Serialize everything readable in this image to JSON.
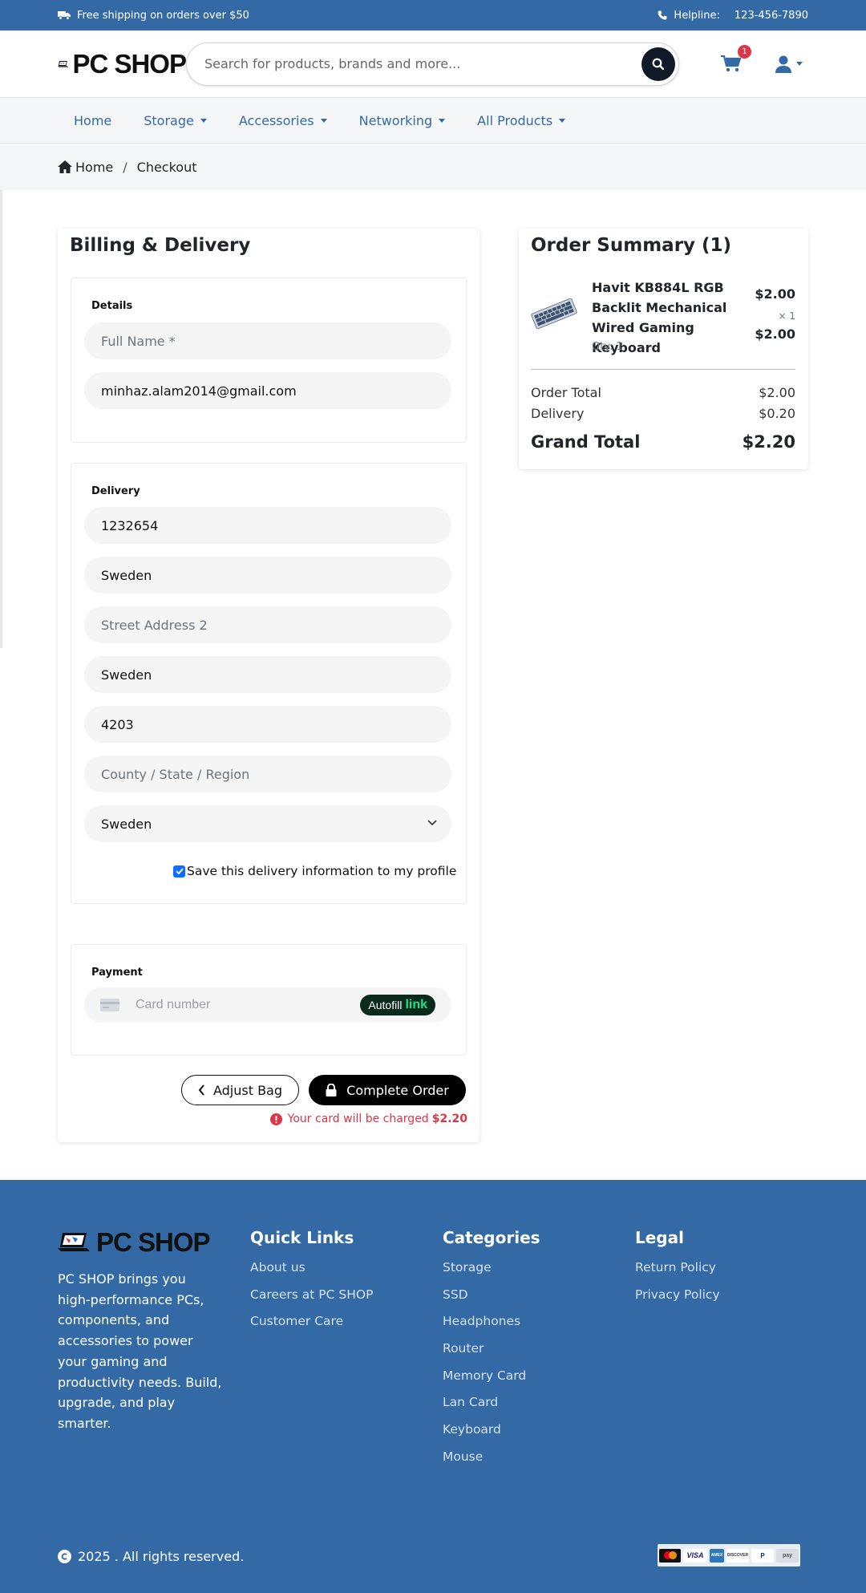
{
  "topbar": {
    "shipping_text": "Free shipping on orders over $50",
    "helpline_label": "Helpline:",
    "helpline_number": "123-456-7890"
  },
  "header": {
    "logo_text": "PC SHOP",
    "search_placeholder": "Search for products, brands and more...",
    "cart_count": "1"
  },
  "nav": {
    "items": [
      {
        "label": "Home"
      },
      {
        "label": "Storage"
      },
      {
        "label": "Accessories"
      },
      {
        "label": "Networking"
      },
      {
        "label": "All Products"
      }
    ]
  },
  "breadcrumb": {
    "home": "Home",
    "separator": "/",
    "current": "Checkout"
  },
  "billing": {
    "title": "Billing & Delivery",
    "details": {
      "label": "Details",
      "full_name_placeholder": "Full Name *",
      "email": "minhaz.alam2014@gmail.com"
    },
    "delivery": {
      "label": "Delivery",
      "phone": "1232654",
      "street1": "Sweden",
      "street2_placeholder": "Street Address 2",
      "city": "Sweden",
      "postcode": "4203",
      "county_placeholder": "County / State / Region",
      "country": "Sweden",
      "save_label": "Save this delivery information to my profile",
      "save_checked": true
    },
    "payment": {
      "label": "Payment",
      "card_placeholder": "Card number",
      "autofill_text": "Autofill",
      "autofill_link": "link"
    },
    "adjust_button": "Adjust Bag",
    "complete_button": "Complete Order",
    "charge_text": "Your card will be charged",
    "charge_amount": "$2.20"
  },
  "summary": {
    "title": "Order Summary (1)",
    "item": {
      "name": "Havit KB884L RGB Backlit Mechanical Wired Gaming Keyboard",
      "qty": "Qty: 1",
      "price": "$2.00",
      "times": "× 1",
      "total": "$2.00"
    },
    "order_total_label": "Order Total",
    "order_total": "$2.00",
    "delivery_label": "Delivery",
    "delivery": "$0.20",
    "grand_total_label": "Grand Total",
    "grand_total": "$2.20"
  },
  "footer": {
    "logo_text": "PC SHOP",
    "about": "PC SHOP brings you high-performance PCs, components, and accessories to power your gaming and productivity needs. Build, upgrade, and play smarter.",
    "quick_links": {
      "title": "Quick Links",
      "items": [
        "About us",
        "Careers at PC SHOP",
        "Customer Care"
      ]
    },
    "categories": {
      "title": "Categories",
      "items": [
        "Storage",
        "SSD",
        "Headphones",
        "Router",
        "Memory Card",
        "Lan Card",
        "Keyboard",
        "Mouse"
      ]
    },
    "legal": {
      "title": "Legal",
      "items": [
        "Return Policy",
        "Privacy Policy"
      ]
    },
    "copyright": "2025 . All rights reserved.",
    "payment_icons": [
      "mastercard-icon",
      "visa-icon",
      "amex-icon",
      "discover-icon",
      "paypal-icon",
      "pay-icon"
    ]
  },
  "colors": {
    "brand_blue": "#336aa6",
    "danger": "#dc3545",
    "dark": "#111827"
  }
}
